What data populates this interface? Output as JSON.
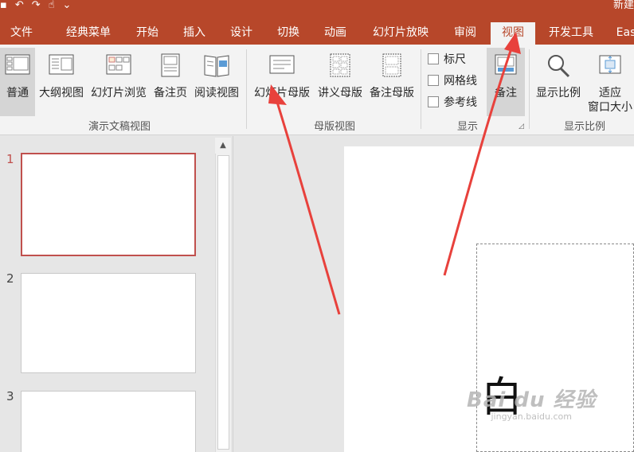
{
  "qat": {
    "save_icon": "save-icon",
    "undo_icon": "undo-icon",
    "redo_icon": "redo-icon",
    "touch_icon": "touch-mode-icon",
    "more_icon": "chevron-down-icon"
  },
  "doc_title": "新建",
  "tabs": [
    {
      "label": "文件"
    },
    {
      "label": "经典菜单"
    },
    {
      "label": "开始"
    },
    {
      "label": "插入"
    },
    {
      "label": "设计"
    },
    {
      "label": "切换"
    },
    {
      "label": "动画"
    },
    {
      "label": "幻灯片放映"
    },
    {
      "label": "审阅"
    },
    {
      "label": "视图"
    },
    {
      "label": "开发工具"
    },
    {
      "label": "Eas"
    }
  ],
  "ribbon": {
    "presentation_views": {
      "group_label": "演示文稿视图",
      "normal": "普通",
      "outline": "大纲视图",
      "slide_sorter": "幻灯片浏览",
      "notes_page": "备注页",
      "reading": "阅读视图"
    },
    "master_views": {
      "group_label": "母版视图",
      "slide_master": "幻灯片母版",
      "handout_master": "讲义母版",
      "notes_master": "备注母版"
    },
    "show": {
      "group_label": "显示",
      "ruler": "标尺",
      "gridlines": "网格线",
      "guides": "参考线",
      "notes": "备注"
    },
    "zoom": {
      "group_label": "显示比例",
      "zoom": "显示比例",
      "fit_line1": "适应",
      "fit_line2": "窗口大小"
    }
  },
  "slides": [
    {
      "num": "1"
    },
    {
      "num": "2"
    },
    {
      "num": "3"
    }
  ],
  "slide_title_char": "白",
  "watermark": {
    "line1": "Bai du 经验",
    "line2": "jingyan.baidu.com"
  },
  "colors": {
    "accent": "#b7472a",
    "selected_slide": "#c0504d",
    "annotation_arrow": "#e8413c"
  }
}
